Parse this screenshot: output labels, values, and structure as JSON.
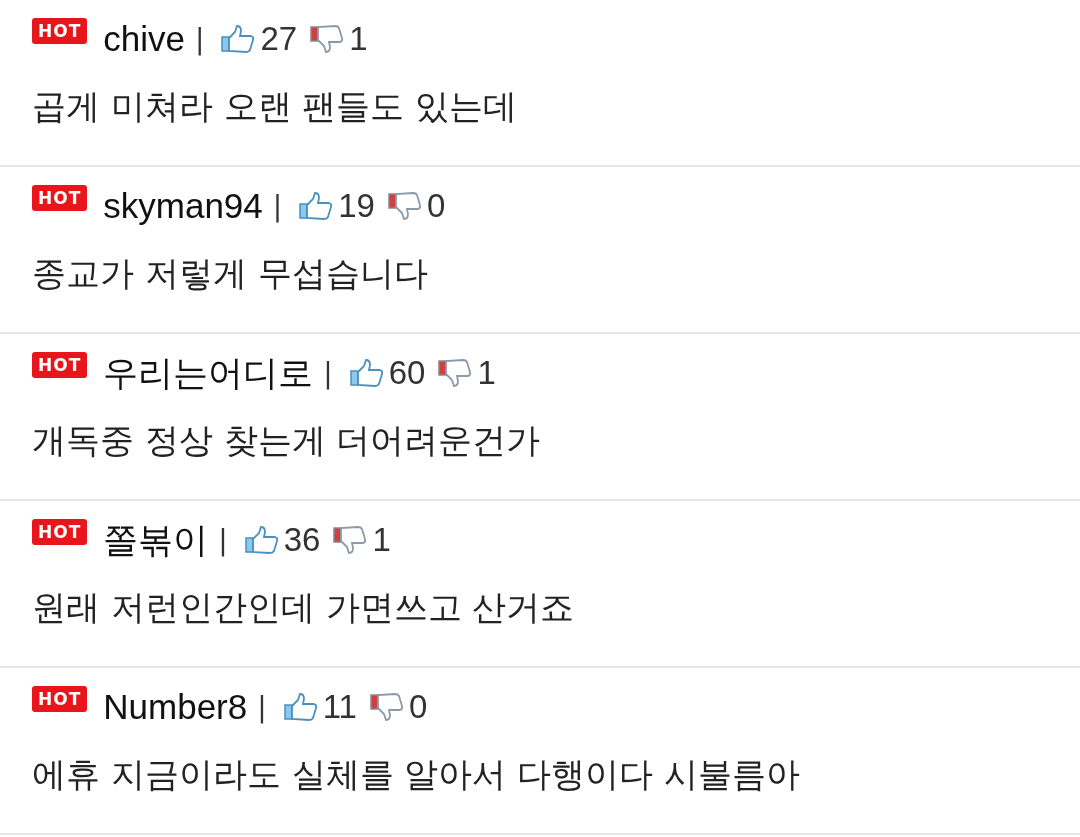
{
  "comments": [
    {
      "badge": "HOT",
      "author": "chive",
      "separator": "|",
      "likes": "27",
      "dislikes": "1",
      "text": "곱게 미쳐라 오랜 팬들도 있는데"
    },
    {
      "badge": "HOT",
      "author": "skyman94",
      "separator": "|",
      "likes": "19",
      "dislikes": "0",
      "text": "종교가 저렇게 무섭습니다"
    },
    {
      "badge": "HOT",
      "author": "우리는어디로",
      "separator": "|",
      "likes": "60",
      "dislikes": "1",
      "text": "개독중 정상 찾는게 더어려운건가"
    },
    {
      "badge": "HOT",
      "author": "쫄볶이",
      "separator": "|",
      "likes": "36",
      "dislikes": "1",
      "text": "원래 저런인간인데 가면쓰고 산거죠"
    },
    {
      "badge": "HOT",
      "author": "Number8",
      "separator": "|",
      "likes": "11",
      "dislikes": "0",
      "text": "에휴 지금이라도 실체를 알아서 다행이다 시불름아"
    }
  ]
}
